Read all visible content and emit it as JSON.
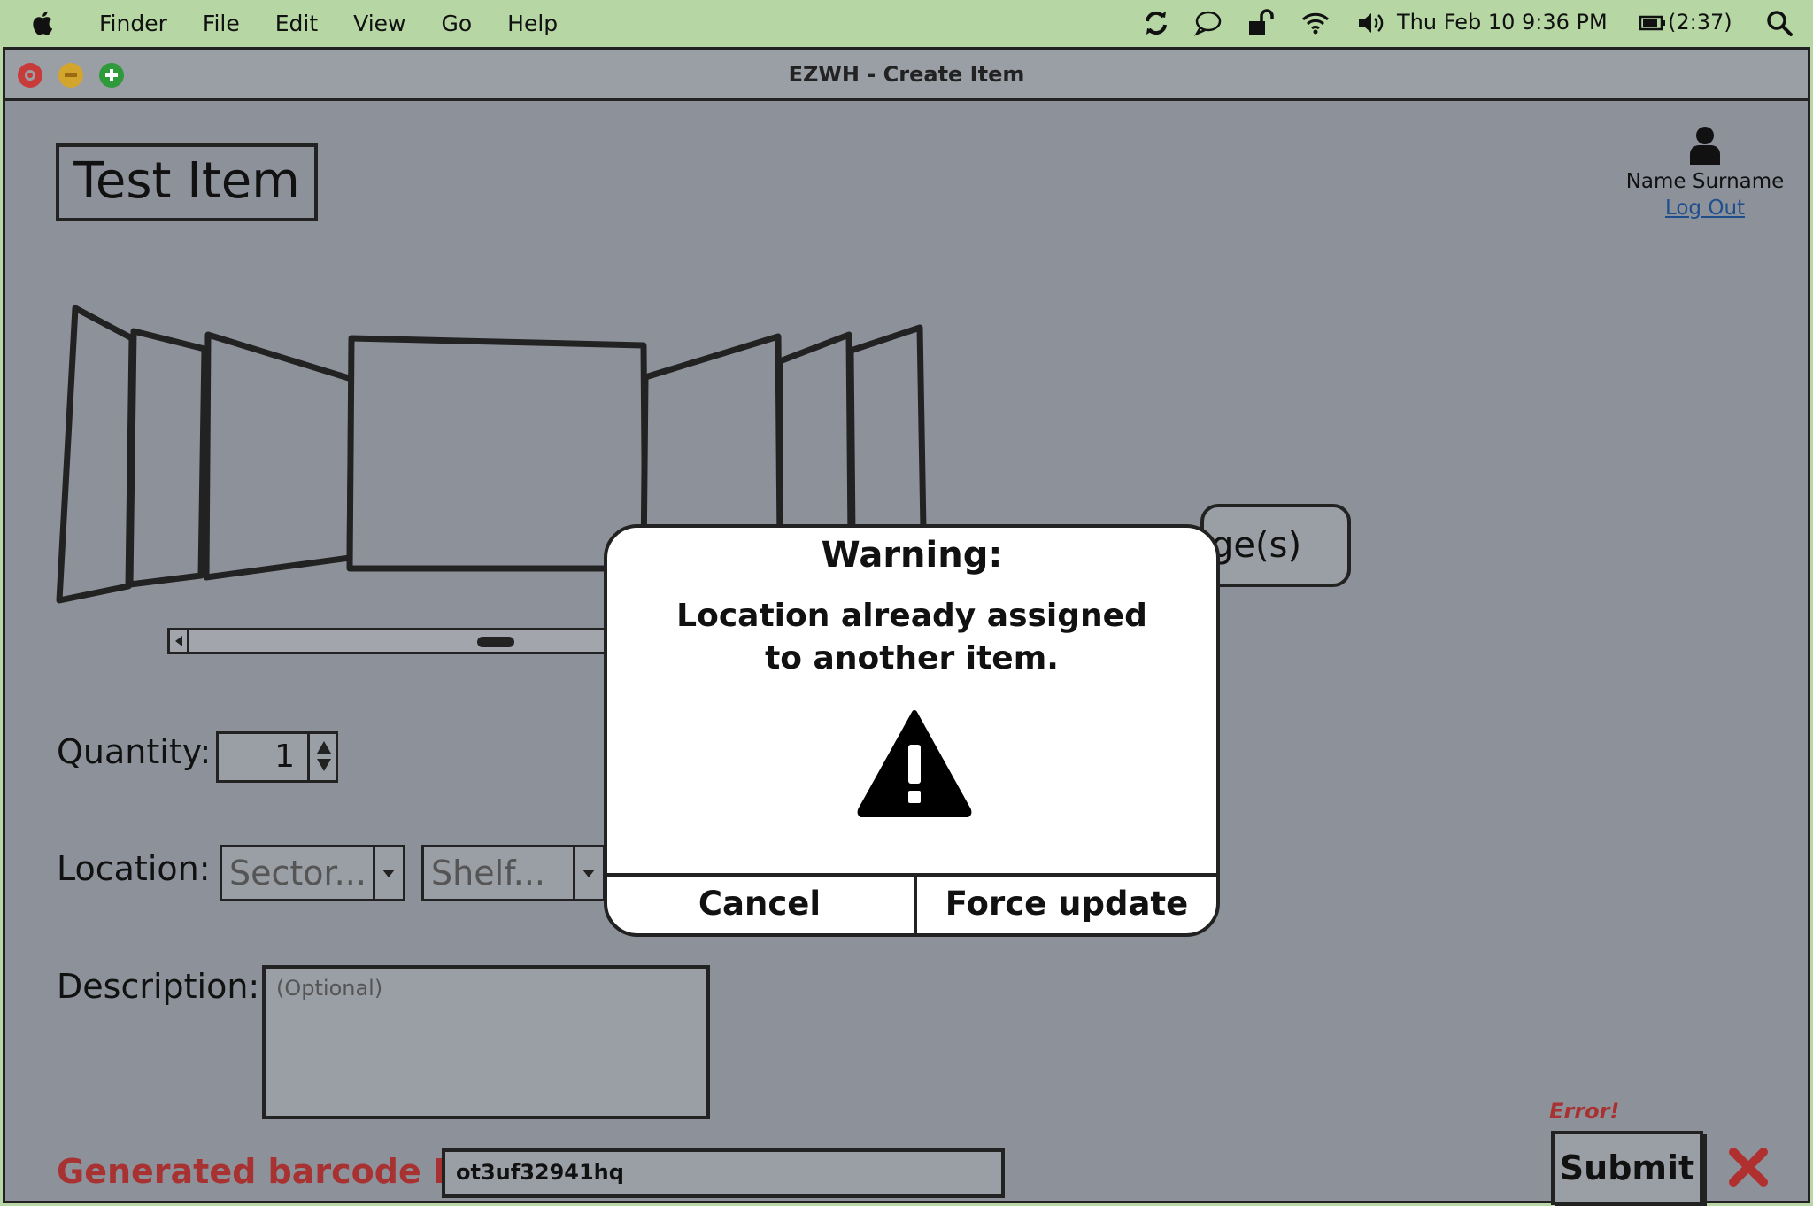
{
  "menubar": {
    "items": [
      "Finder",
      "File",
      "Edit",
      "View",
      "Go",
      "Help"
    ],
    "datetime": "Thu Feb 10  9:36 PM",
    "battery": "(2:37)"
  },
  "window": {
    "title": "EZWH - Create Item"
  },
  "page": {
    "item_title": "Test Item",
    "user_name": "Name Surname",
    "logout_label": "Log Out",
    "upload_label": "ge(s)",
    "quantity_label": "Quantity:",
    "quantity_value": "1",
    "location_label": "Location:",
    "sector_placeholder": "Sector...",
    "shelf_placeholder": "Shelf...",
    "description_label": "Description:",
    "description_placeholder": "(Optional)",
    "barcode_label": "Generated barcode ID:",
    "barcode_value": "ot3uf32941hq",
    "error_text": "Error!",
    "submit_label": "Submit"
  },
  "dialog": {
    "title": "Warning:",
    "message": "Location already assigned to another item.",
    "cancel_label": "Cancel",
    "force_label": "Force update"
  },
  "colors": {
    "menubar": "#b6d6a4",
    "window_bg": "#8d929a",
    "error": "#a83232",
    "link": "#1f4e8c"
  }
}
